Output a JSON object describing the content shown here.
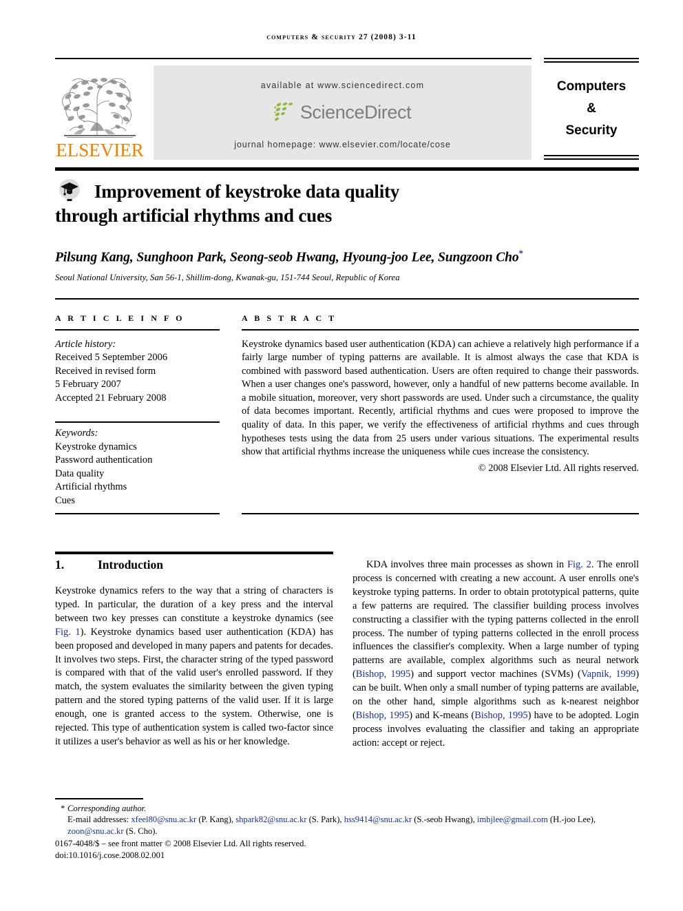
{
  "running_head": "Computers & Security 27 (2008) 3-11",
  "masthead": {
    "available_at": "available at www.sciencedirect.com",
    "journal_homepage": "journal homepage: www.elsevier.com/locate/cose",
    "sciencedirect_logo_text": "ScienceDirect",
    "publisher_logo_text": "ELSEVIER",
    "publisher_logo_color": "#f08000",
    "sciencedirect_text_color": "#7d7d7d",
    "sciencedirect_mark_color": "#8cb83c",
    "band_background": "#e6e6e6",
    "journal_title_lines": [
      "Computers",
      "&",
      "Security"
    ]
  },
  "article": {
    "title_line_1": "Improvement of keystroke data quality",
    "title_line_2": "through artificial rhythms and cues",
    "authors": "Pilsung Kang, Sunghoon Park, Seong-seob Hwang, Hyoung-joo Lee, Sungzoon Cho",
    "corresponding_marker": "*",
    "affiliation": "Seoul National University, San 56-1, Shillim-dong, Kwanak-gu, 151-744 Seoul, Republic of Korea"
  },
  "article_info": {
    "heading": "A R T I C L E    I N F O",
    "history_label": "Article history:",
    "history_lines": [
      "Received 5 September 2006",
      "Received in revised form",
      "5 February 2007",
      "Accepted 21 February 2008"
    ],
    "keywords_label": "Keywords:",
    "keywords": [
      "Keystroke dynamics",
      "Password authentication",
      "Data quality",
      "Artificial rhythms",
      "Cues"
    ]
  },
  "abstract": {
    "heading": "A B S T R A C T",
    "text": "Keystroke dynamics based user authentication (KDA) can achieve a relatively high performance if a fairly large number of typing patterns are available. It is almost always the case that KDA is combined with password based authentication. Users are often required to change their passwords. When a user changes one's password, however, only a handful of new patterns become available. In a mobile situation, moreover, very short passwords are used. Under such a circumstance, the quality of data becomes important. Recently, artificial rhythms and cues were proposed to improve the quality of data. In this paper, we verify the effectiveness of artificial rhythms and cues through hypotheses tests using the data from 25 users under various situations. The experimental results show that artificial rhythms increase the uniqueness while cues increase the consistency.",
    "copyright": "© 2008 Elsevier Ltd. All rights reserved."
  },
  "section": {
    "number": "1.",
    "title": "Introduction"
  },
  "body": {
    "left_paragraph_part_1": "Keystroke dynamics refers to the way that a string of characters is typed. In particular, the duration of a key press and the interval between two key presses can constitute a keystroke dynamics (see ",
    "left_ref_fig1": "Fig. 1",
    "left_paragraph_part_2": "). Keystroke dynamics based user authentication (KDA) has been proposed and developed in many papers and patents for decades. It involves two steps. First, the character string of the typed password is compared with that of the valid user's enrolled password. If they match, the system evaluates the similarity between the given typing pattern and the stored typing patterns of the valid user. If it is large enough, one is granted access to the system. Otherwise, one is rejected. This type of authentication system is called two-factor since it utilizes a user's behavior as well as his or her knowledge.",
    "right_part_1": "KDA involves three main processes as shown in ",
    "right_ref_fig2": "Fig. 2",
    "right_part_2": ". The enroll process is concerned with creating a new account. A user enrolls one's keystroke typing patterns. In order to obtain prototypical patterns, quite a few patterns are required. The classifier building process involves constructing a classifier with the typing patterns collected in the enroll process. The number of typing patterns collected in the enroll process influences the classifier's complexity. When a large number of typing patterns are available, complex algorithms such as neural network (",
    "right_ref_bishop_1": "Bishop, 1995",
    "right_part_3": ") and support vector machines (SVMs) (",
    "right_ref_vapnik": "Vapnik, 1999",
    "right_part_4": ") can be built. When only a small number of typing patterns are available, on the other hand, simple algorithms such as k-nearest neighbor (",
    "right_ref_bishop_2": "Bishop, 1995",
    "right_part_5": ") and K-means (",
    "right_ref_bishop_3": "Bishop, 1995",
    "right_part_6": ") have to be adopted. Login process involves evaluating the classifier and taking an appropriate action: accept or reject.",
    "reference_link_color": "#1a2f8a"
  },
  "footnote": {
    "corresponding_marker": "*",
    "corresponding_author": "Corresponding author.",
    "email_label": "E-mail addresses:",
    "emails": [
      {
        "address": "xfeel80@snu.ac.kr",
        "person": "(P. Kang)"
      },
      {
        "address": "shpark82@snu.ac.kr",
        "person": "(S. Park)"
      },
      {
        "address": "hss9414@snu.ac.kr",
        "person": "(S.-seob Hwang)"
      },
      {
        "address": "imhjlee@gmail.com",
        "person": "(H.-joo Lee)"
      },
      {
        "address": "zoon@snu.ac.kr",
        "person": "(S. Cho)"
      }
    ],
    "issn_line": "0167-4048/$ – see front matter © 2008 Elsevier Ltd. All rights reserved.",
    "doi_line": "doi:10.1016/j.cose.2008.02.001"
  }
}
